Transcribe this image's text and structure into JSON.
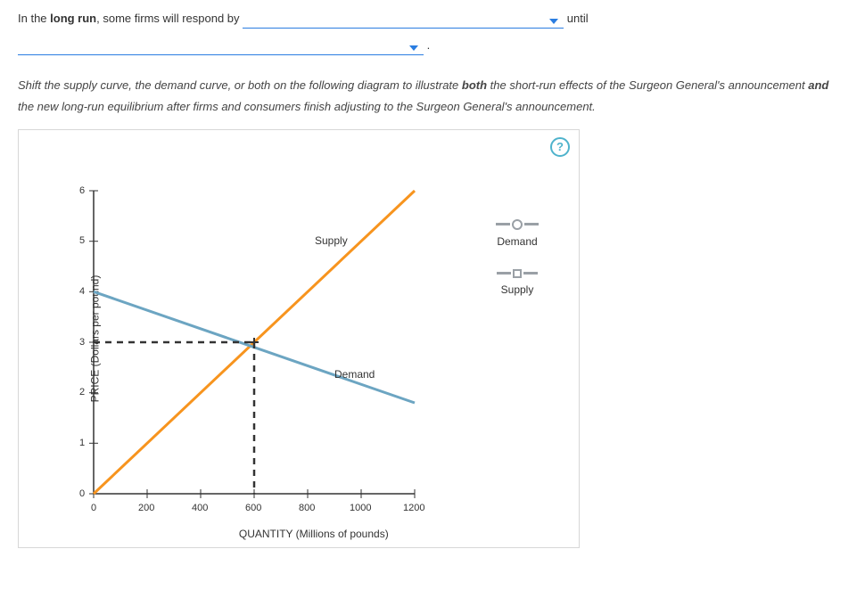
{
  "question": {
    "part1": "In the ",
    "part1_strong": "long run",
    "part2": ", some firms will respond by ",
    "part3": " until",
    "part4": "."
  },
  "instructions": {
    "p1": "Shift the supply curve, the demand curve, or both on the following diagram to illustrate ",
    "b1": "both",
    "p2": " the short-run effects of the Surgeon General's announcement ",
    "b2": "and",
    "p3": " the new long-run equilibrium after firms and consumers finish adjusting to the Surgeon General's announcement."
  },
  "help_label": "?",
  "legend": {
    "demand": "Demand",
    "supply": "Supply"
  },
  "chart_data": {
    "type": "line",
    "title": "",
    "xlabel": "QUANTITY (Millions of pounds)",
    "ylabel": "PRICE (Dollars per pound)",
    "xlim": [
      0,
      1200
    ],
    "ylim": [
      0,
      6
    ],
    "x_ticks": [
      0,
      200,
      400,
      600,
      800,
      1000,
      1200
    ],
    "y_ticks": [
      0,
      1,
      2,
      3,
      4,
      5,
      6
    ],
    "series": [
      {
        "name": "Supply",
        "color": "#f7941e",
        "x": [
          0,
          1200
        ],
        "y": [
          0,
          6
        ]
      },
      {
        "name": "Demand",
        "color": "#6ca5c2",
        "x": [
          0,
          1200
        ],
        "y": [
          4,
          1.8
        ]
      }
    ],
    "annotations": {
      "equilibrium": {
        "x": 600,
        "y": 3
      },
      "supply_label_at": {
        "x": 920,
        "y": 5
      },
      "demand_label_at": {
        "x": 940,
        "y": 2.3
      }
    }
  }
}
